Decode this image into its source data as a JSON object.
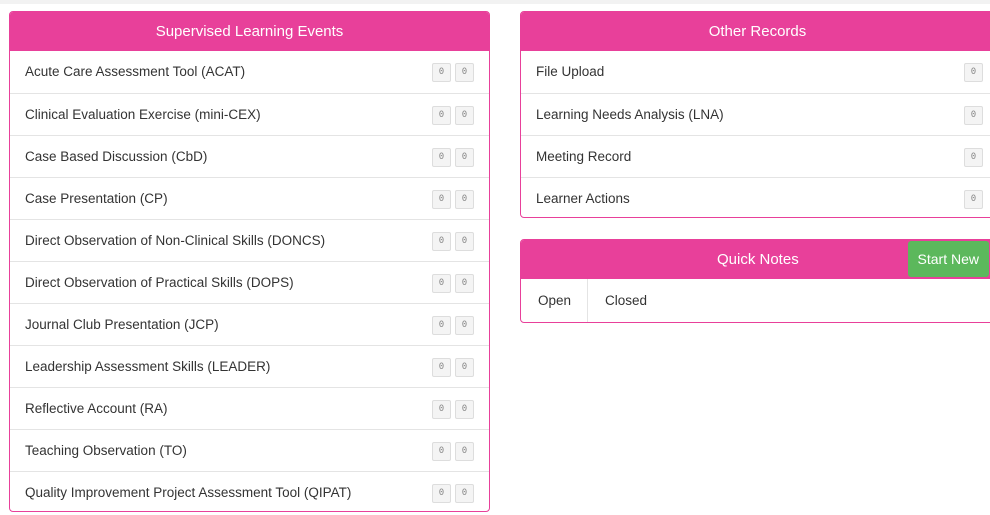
{
  "sle": {
    "title": "Supervised Learning Events",
    "items": [
      {
        "label": "Acute Care Assessment Tool (ACAT)",
        "c1": "0",
        "c2": "0"
      },
      {
        "label": "Clinical Evaluation Exercise (mini-CEX)",
        "c1": "0",
        "c2": "0"
      },
      {
        "label": "Case Based Discussion (CbD)",
        "c1": "0",
        "c2": "0"
      },
      {
        "label": "Case Presentation (CP)",
        "c1": "0",
        "c2": "0"
      },
      {
        "label": "Direct Observation of Non-Clinical Skills (DONCS)",
        "c1": "0",
        "c2": "0"
      },
      {
        "label": "Direct Observation of Practical Skills (DOPS)",
        "c1": "0",
        "c2": "0"
      },
      {
        "label": "Journal Club Presentation (JCP)",
        "c1": "0",
        "c2": "0"
      },
      {
        "label": "Leadership Assessment Skills (LEADER)",
        "c1": "0",
        "c2": "0"
      },
      {
        "label": "Reflective Account (RA)",
        "c1": "0",
        "c2": "0"
      },
      {
        "label": "Teaching Observation (TO)",
        "c1": "0",
        "c2": "0"
      },
      {
        "label": "Quality Improvement Project Assessment Tool (QIPAT)",
        "c1": "0",
        "c2": "0"
      }
    ]
  },
  "other": {
    "title": "Other Records",
    "items": [
      {
        "label": "File Upload",
        "c1": "0"
      },
      {
        "label": "Learning Needs Analysis (LNA)",
        "c1": "0"
      },
      {
        "label": "Meeting Record",
        "c1": "0"
      },
      {
        "label": "Learner Actions",
        "c1": "0"
      }
    ]
  },
  "notes": {
    "title": "Quick Notes",
    "start_label": "Start New",
    "tabs": [
      "Open",
      "Closed"
    ]
  },
  "colors": {
    "accent": "#e8409a",
    "success": "#5cb85c"
  }
}
